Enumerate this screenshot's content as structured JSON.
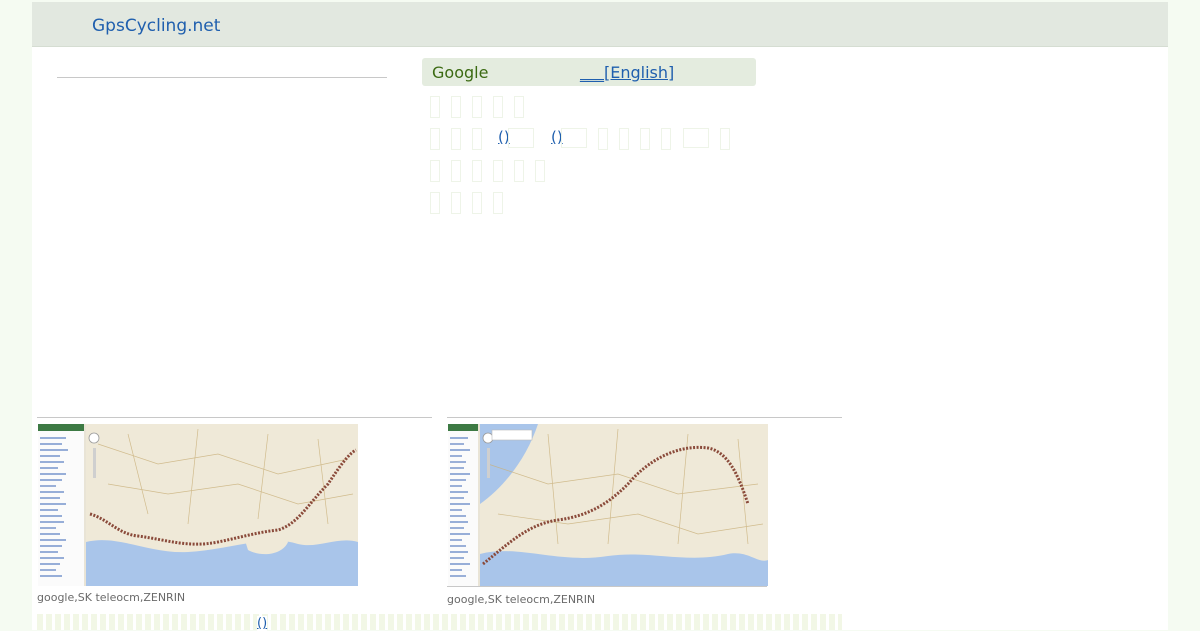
{
  "site": {
    "brand": "GpsCycling.net"
  },
  "lang_bar": {
    "google": "Google",
    "english": "___[English]"
  },
  "menu": {
    "paren_1": "()",
    "paren_2": "()"
  },
  "thumbnails": [
    {
      "credit": "google,SK teleocm,ZENRIN"
    },
    {
      "credit": "google,SK teleocm,ZENRIN"
    }
  ],
  "footer": {
    "paren": "()"
  },
  "colors": {
    "link": "#1f5fae",
    "topbar": "#e2e8e0",
    "lang_bar": "#e4ecdf",
    "google_text": "#3b6a12"
  }
}
